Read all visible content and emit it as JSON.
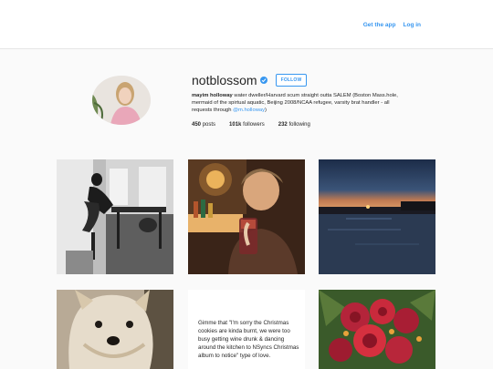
{
  "header": {
    "get_app_label": "Get the app",
    "login_label": "Log in"
  },
  "profile": {
    "username": "notblossom",
    "follow_label": "FOLLOW",
    "bio_name": "mayim holloway",
    "bio_text": " water dweller/Harvard scum straight outta SALEM (Boston Mass.hole, mermaid of the spirtual aquatic, Beijing 2008/NCAA refugee, varsity brat handler - all requests through ",
    "bio_mention": "@m.holloway",
    "bio_end": ")",
    "stats": {
      "posts_value": "450",
      "posts_label": "posts",
      "followers_value": "101k",
      "followers_label": "followers",
      "following_value": "232",
      "following_label": "following"
    }
  },
  "posts": {
    "text_post": "Gimme that \"I'm sorry the Christmas cookies are kinda burnt, we were too busy getting wine drunk & dancing around the kitchen to NSyncs Christmas album to notice\" type of love."
  },
  "colors": {
    "accent": "#3897f0",
    "background": "#fafafa"
  }
}
